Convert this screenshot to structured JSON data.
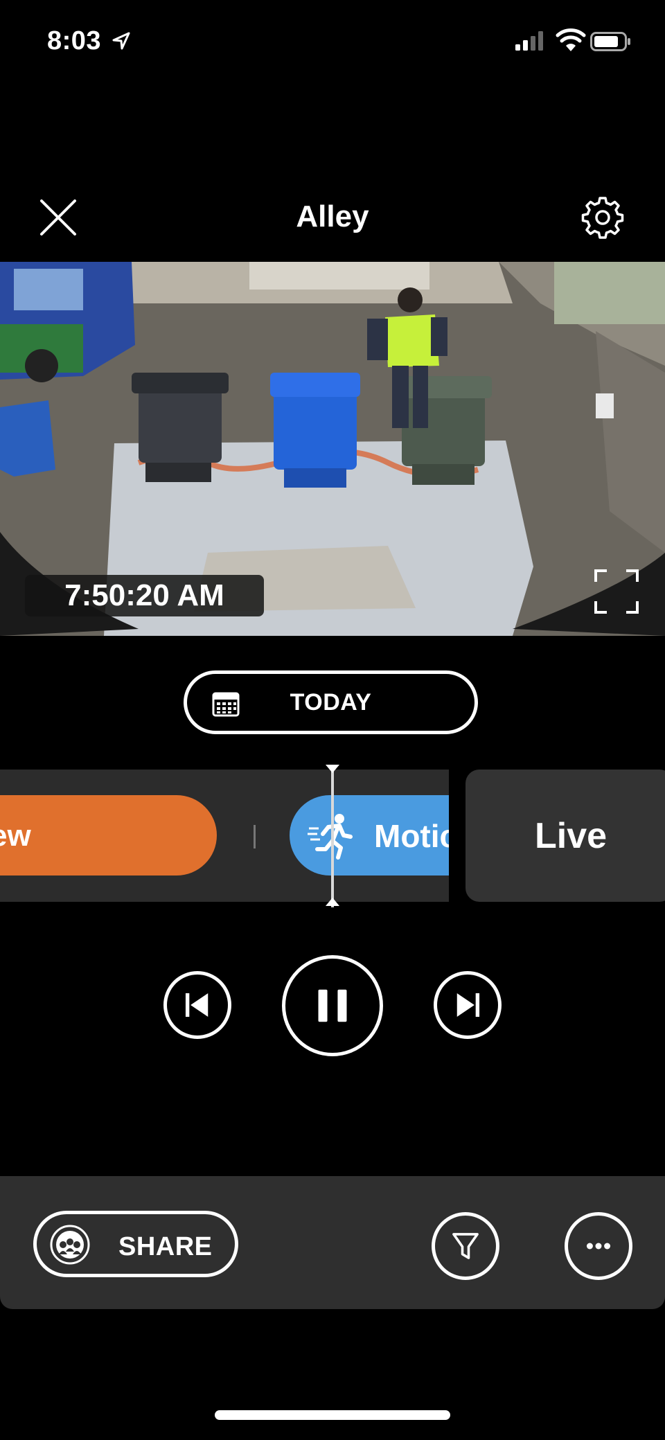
{
  "status_bar": {
    "time": "8:03",
    "icons": [
      "location-arrow-icon",
      "cellular-signal-icon",
      "wifi-icon",
      "battery-icon"
    ]
  },
  "header": {
    "title": "Alley",
    "left_icon": "close-icon",
    "right_icon": "gear-icon"
  },
  "video": {
    "timestamp": "7:50:20 AM",
    "fullscreen_icon": "fullscreen-icon"
  },
  "date_selector": {
    "label": "TODAY",
    "icon": "calendar-icon"
  },
  "timeline": {
    "events": [
      {
        "label": "ew",
        "type": "new",
        "color": "#e0702d"
      },
      {
        "label": "Motic",
        "type": "motion",
        "color": "#4a9be0",
        "icon": "running-person-icon"
      }
    ],
    "live_label": "Live"
  },
  "playback": {
    "controls": [
      "skip-previous-icon",
      "pause-icon",
      "skip-next-icon"
    ]
  },
  "bottom_bar": {
    "share_label": "SHARE",
    "share_icon": "neighbors-share-icon",
    "filter_icon": "filter-icon",
    "more_icon": "more-dots-icon"
  },
  "colors": {
    "background": "#000000",
    "accent_orange": "#e0702d",
    "accent_blue": "#4a9be0",
    "panel": "#2f2f2f"
  }
}
